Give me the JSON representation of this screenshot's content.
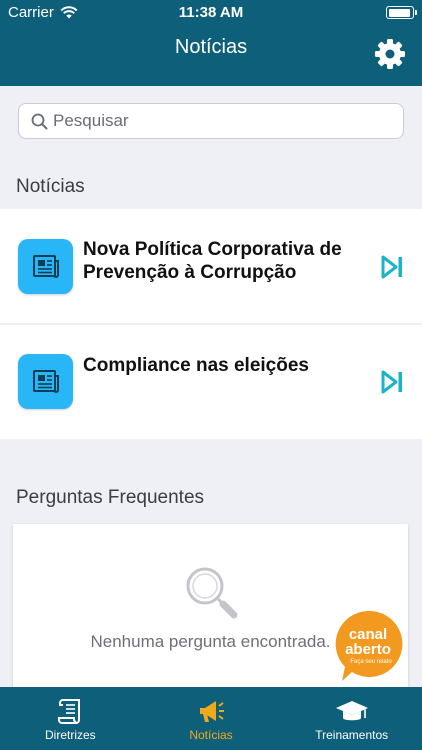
{
  "status_bar": {
    "carrier": "Carrier",
    "time": "11:38 AM"
  },
  "header": {
    "title": "Notícias"
  },
  "search": {
    "placeholder": "Pesquisar"
  },
  "news_section": {
    "title": "Notícias",
    "items": [
      {
        "title": "Nova Política Corporativa de Prevenção à Corrupção"
      },
      {
        "title": "Compliance nas eleições"
      }
    ]
  },
  "faq_section": {
    "title": "Perguntas Frequentes",
    "empty_text": "Nenhuma pergunta encontrada."
  },
  "canal_badge": {
    "line1": "canal",
    "line2": "aberto",
    "line3": "Faça seu relato"
  },
  "tabbar": {
    "tabs": [
      {
        "label": "Diretrizes"
      },
      {
        "label": "Notícias"
      },
      {
        "label": "Treinamentos"
      }
    ]
  },
  "colors": {
    "header": "#0e5f7a",
    "accent": "#f2a81d",
    "news_icon": "#29b6f6",
    "go_icon": "#1ab3c8",
    "canal_badge": "#f29a1f"
  }
}
